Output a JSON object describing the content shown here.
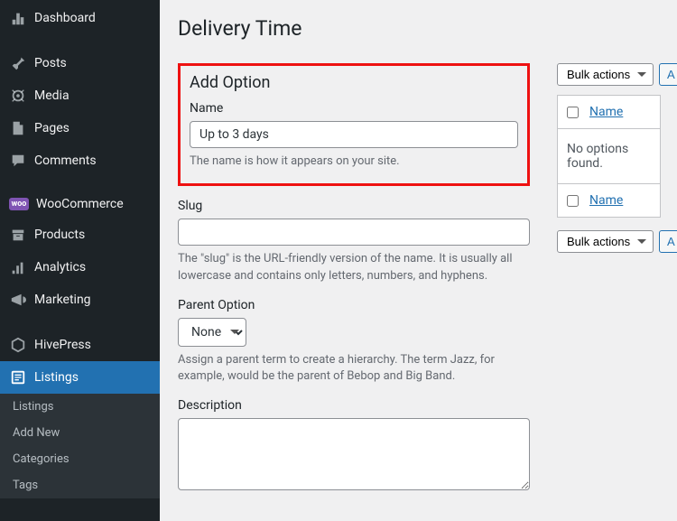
{
  "sidebar": {
    "items": [
      {
        "icon": "dashboard",
        "label": "Dashboard"
      },
      {
        "icon": "pin",
        "label": "Posts"
      },
      {
        "icon": "media",
        "label": "Media"
      },
      {
        "icon": "page",
        "label": "Pages"
      },
      {
        "icon": "comment",
        "label": "Comments"
      },
      {
        "icon": "woo",
        "label": "WooCommerce"
      },
      {
        "icon": "archive",
        "label": "Products"
      },
      {
        "icon": "chart",
        "label": "Analytics"
      },
      {
        "icon": "megaphone",
        "label": "Marketing"
      },
      {
        "icon": "hivepress",
        "label": "HivePress"
      },
      {
        "icon": "listings",
        "label": "Listings"
      }
    ],
    "submenu": [
      "Listings",
      "Add New",
      "Categories",
      "Tags"
    ]
  },
  "page": {
    "title": "Delivery Time"
  },
  "form": {
    "heading": "Add Option",
    "name": {
      "label": "Name",
      "value": "Up to 3 days",
      "desc": "The name is how it appears on your site."
    },
    "slug": {
      "label": "Slug",
      "value": "",
      "desc": "The \"slug\" is the URL-friendly version of the name. It is usually all lowercase and contains only letters, numbers, and hyphens."
    },
    "parent": {
      "label": "Parent Option",
      "value": "None",
      "desc": "Assign a parent term to create a hierarchy. The term Jazz, for example, would be the parent of Bebop and Big Band."
    },
    "description": {
      "label": "Description",
      "value": ""
    }
  },
  "list": {
    "bulk_label": "Bulk actions",
    "apply_label": "A",
    "col_name": "Name",
    "empty": "No options found."
  }
}
